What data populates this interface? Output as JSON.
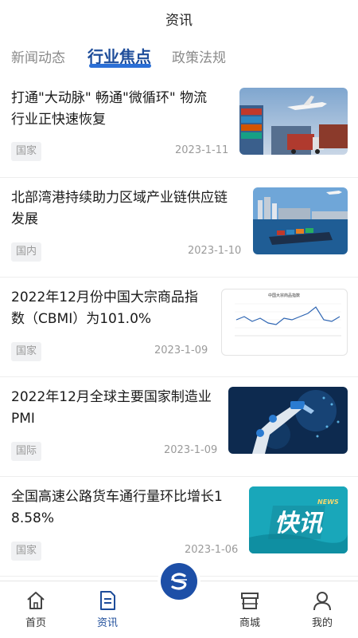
{
  "header": {
    "title": "资讯"
  },
  "tabs": [
    {
      "label": "新闻动态",
      "active": false
    },
    {
      "label": "行业焦点",
      "active": true
    },
    {
      "label": "政策法规",
      "active": false
    }
  ],
  "articles": [
    {
      "title_line1": "打通\"大动脉\" 畅通\"微循环\" 物流",
      "title_line2": "行业正快速恢复",
      "tag": "国家",
      "date": "2023-1-11",
      "thumb": "logistics-port-truck-plane"
    },
    {
      "title_line1": "北部湾港持续助力区域产业链供应链",
      "title_line2": "发展",
      "tag": "国内",
      "date": "2023-1-10",
      "thumb": "container-ship-harbor"
    },
    {
      "title_line1": "2022年12月份中国大宗商品指",
      "title_line2": "数（CBMI）为101.0%",
      "tag": "国家",
      "date": "2023-1-09",
      "thumb": "cbmi-line-chart",
      "thumb_chart_title": "中国大宗商品指数"
    },
    {
      "title_line1": "2022年12月全球主要国家制造业",
      "title_line2": "PMI",
      "tag": "国际",
      "date": "2023-1-09",
      "thumb": "robot-arm-manufacturing"
    },
    {
      "title_line1": "全国高速公路货车通行量环比增长1",
      "title_line2": "8.58%",
      "tag": "国家",
      "date": "2023-1-06",
      "thumb": "kuaixun-banner",
      "thumb_banner_text": "快讯",
      "thumb_banner_sub": "NEWS"
    }
  ],
  "tabbar": [
    {
      "label": "首页",
      "icon": "home-icon",
      "active": false
    },
    {
      "label": "资讯",
      "icon": "document-icon",
      "active": true
    },
    {
      "label": "商城",
      "icon": "shop-icon",
      "active": false
    },
    {
      "label": "我的",
      "icon": "user-icon",
      "active": false
    }
  ],
  "colors": {
    "accent": "#1e4d9a",
    "underline": "#2b6fd6",
    "muted": "#9a9a9a",
    "tag_bg": "#f0f1f3"
  }
}
